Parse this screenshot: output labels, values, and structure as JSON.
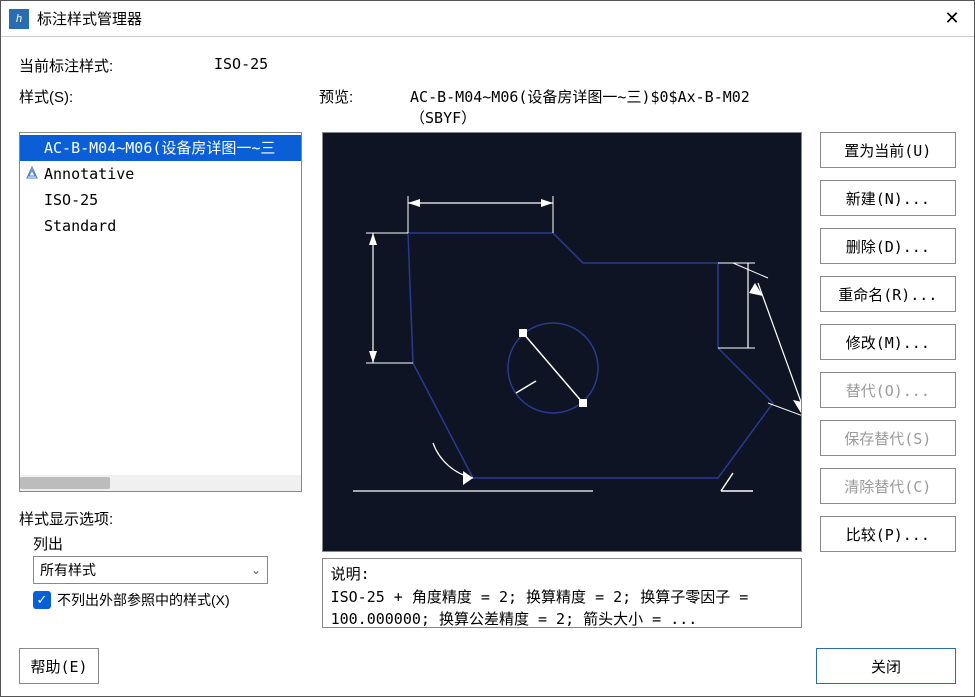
{
  "window": {
    "title": "标注样式管理器"
  },
  "current_style_label": "当前标注样式:",
  "current_style_value": "ISO-25",
  "styles_label": "样式(S):",
  "preview_label": "预览:",
  "preview_name": "AC-B-M04~M06(设备房详图一~三)$0$Ax-B-M02（SBYF）",
  "style_list": [
    {
      "label": "AC-B-M04~M06(设备房详图一~三",
      "selected": true,
      "annotative": false
    },
    {
      "label": "Annotative",
      "selected": false,
      "annotative": true
    },
    {
      "label": "ISO-25",
      "selected": false,
      "annotative": false
    },
    {
      "label": "Standard",
      "selected": false,
      "annotative": false
    }
  ],
  "display_options": {
    "title": "样式显示选项:",
    "list_label": "列出",
    "dropdown_value": "所有样式",
    "checkbox_label": "不列出外部参照中的样式(X)",
    "checkbox_checked": true
  },
  "description": {
    "label": "说明:",
    "text": "ISO-25 + 角度精度 = 2; 换算精度 = 2; 换算子零因子 = 100.000000; 换算公差精度 = 2; 箭头大小  = ..."
  },
  "buttons": {
    "set_current": "置为当前(U)",
    "new": "新建(N)...",
    "delete": "删除(D)...",
    "rename": "重命名(R)...",
    "modify": "修改(M)...",
    "override": "替代(O)...",
    "save_override": "保存替代(S)",
    "clear_override": "清除替代(C)",
    "compare": "比较(P)...",
    "help": "帮助(E)",
    "close": "关闭"
  }
}
